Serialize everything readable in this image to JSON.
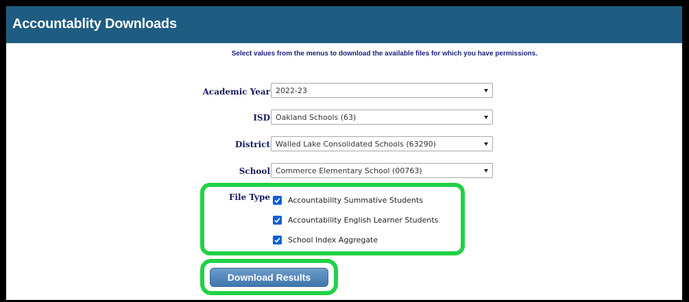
{
  "header": {
    "title": "Accountablity Downloads"
  },
  "instructions": "Select values from the menus to download the available files for which you have permissions.",
  "form": {
    "academic_year": {
      "label": "Academic Year",
      "value": "2022-23"
    },
    "isd": {
      "label": "ISD",
      "value": "Oakland Schools (63)"
    },
    "district": {
      "label": "District",
      "value": "Walled Lake Consolidated Schools (63290)"
    },
    "school": {
      "label": "School",
      "value": "Commerce Elementary School (00763)"
    },
    "file_type": {
      "label": "File Type",
      "options": [
        {
          "label": "Accountability Summative Students",
          "checked": true
        },
        {
          "label": "Accountability English Learner Students",
          "checked": true
        },
        {
          "label": "School Index Aggregate",
          "checked": true
        }
      ]
    }
  },
  "download_button": {
    "label": "Download Results"
  },
  "colors": {
    "header_bg": "#1f5c82",
    "highlight": "#21d246",
    "checkbox": "#0b5fd6",
    "label_text": "#151b5c"
  },
  "icons": {
    "checkbox": "checkmark-icon",
    "select": "chevron-down-icon"
  }
}
